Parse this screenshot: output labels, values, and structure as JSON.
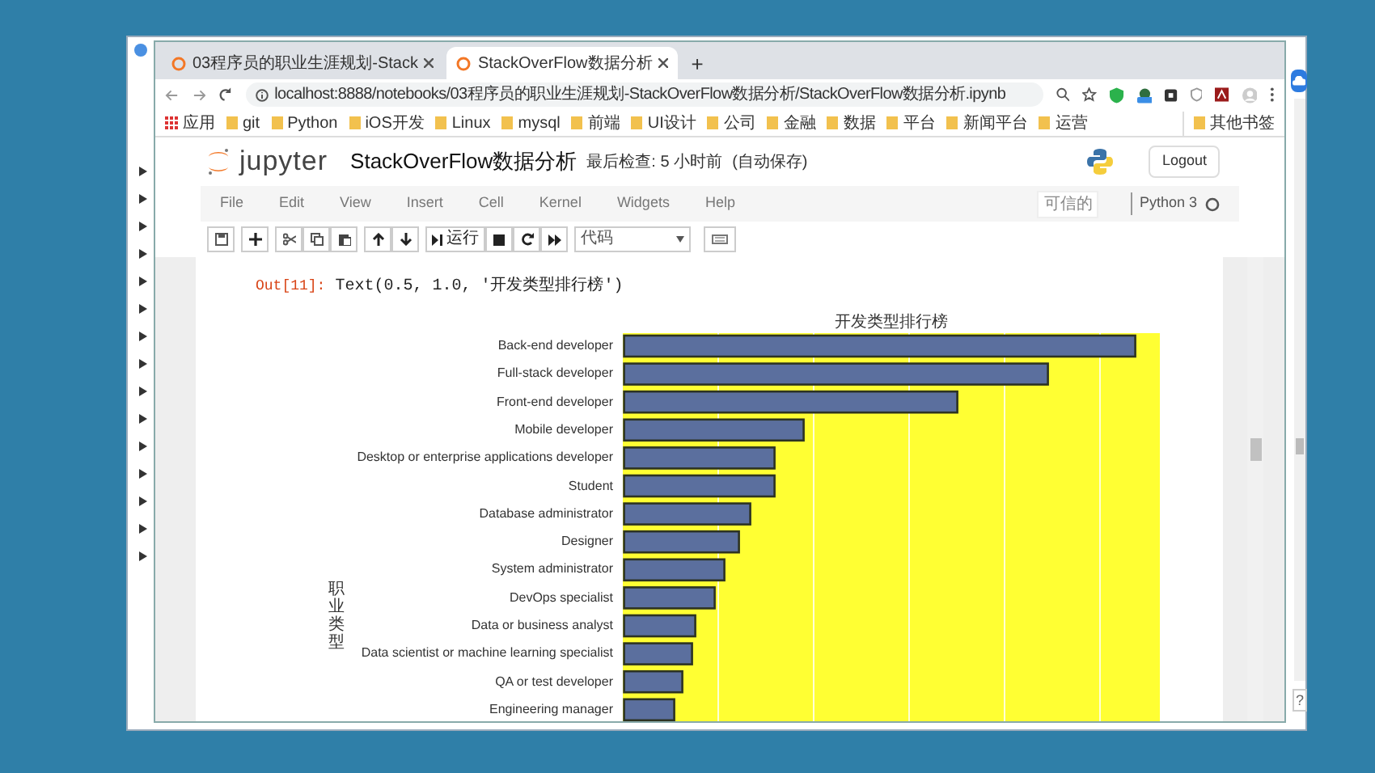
{
  "browser": {
    "tabs": [
      {
        "title": "03程序员的职业生涯规划-Stack",
        "selected": false
      },
      {
        "title": "StackOverFlow数据分析",
        "selected": true
      }
    ],
    "new_tab": "+",
    "url": "localhost:8888/notebooks/03程序员的职业生涯规划-StackOverFlow数据分析/StackOverFlow数据分析.ipynb",
    "bookmarks": [
      "应用",
      "git",
      "Python",
      "iOS开发",
      "Linux",
      "mysql",
      "前端",
      "UI设计",
      "公司",
      "金融",
      "数据",
      "平台",
      "新闻平台",
      "运营"
    ],
    "other_bookmarks": "其他书签"
  },
  "jupyter": {
    "logo_text": "jupyter",
    "notebook_title": "StackOverFlow数据分析",
    "checkpoint": "最后检查: 5 小时前",
    "autosave": "(自动保存)",
    "logout": "Logout",
    "menu": [
      "File",
      "Edit",
      "View",
      "Insert",
      "Cell",
      "Kernel",
      "Widgets",
      "Help"
    ],
    "trusted": "可信的",
    "kernel": "Python 3",
    "run_button": "运行",
    "cell_type": "代码"
  },
  "output": {
    "prompt": "Out[11]:",
    "text": "Text(0.5, 1.0, '开发类型排行榜')"
  },
  "chart": {
    "title": "开发类型排行榜",
    "ylabel": "职业类型",
    "categories": [
      "Back-end developer",
      "Full-stack developer",
      "Front-end developer",
      "Mobile developer",
      "Desktop or enterprise applications developer",
      "Student",
      "Database administrator",
      "Designer",
      "System administrator",
      "DevOps specialist",
      "Data or business analyst",
      "Data scientist or machine learning specialist",
      "QA or test developer",
      "Engineering manager"
    ]
  },
  "help_button": "?"
}
